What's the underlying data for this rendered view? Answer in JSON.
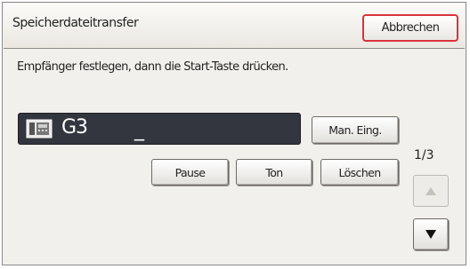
{
  "header": {
    "title": "Speicherdateitransfer",
    "cancel_label": "Abbrechen"
  },
  "instruction": "Empfänger festlegen, dann die Start-Taste drücken.",
  "destination": {
    "icon": "fax-icon",
    "mode": "G3",
    "entry": "_"
  },
  "buttons": {
    "manual_entry": "Man. Eing.",
    "pause": "Pause",
    "tone": "Ton",
    "delete": "Löschen"
  },
  "pager": {
    "label": "1/3",
    "up_enabled": false,
    "down_enabled": true
  },
  "colors": {
    "cancel_border": "#d9323b",
    "dest_bar": "#33363f",
    "panel_bg": "#f2f0ec"
  }
}
